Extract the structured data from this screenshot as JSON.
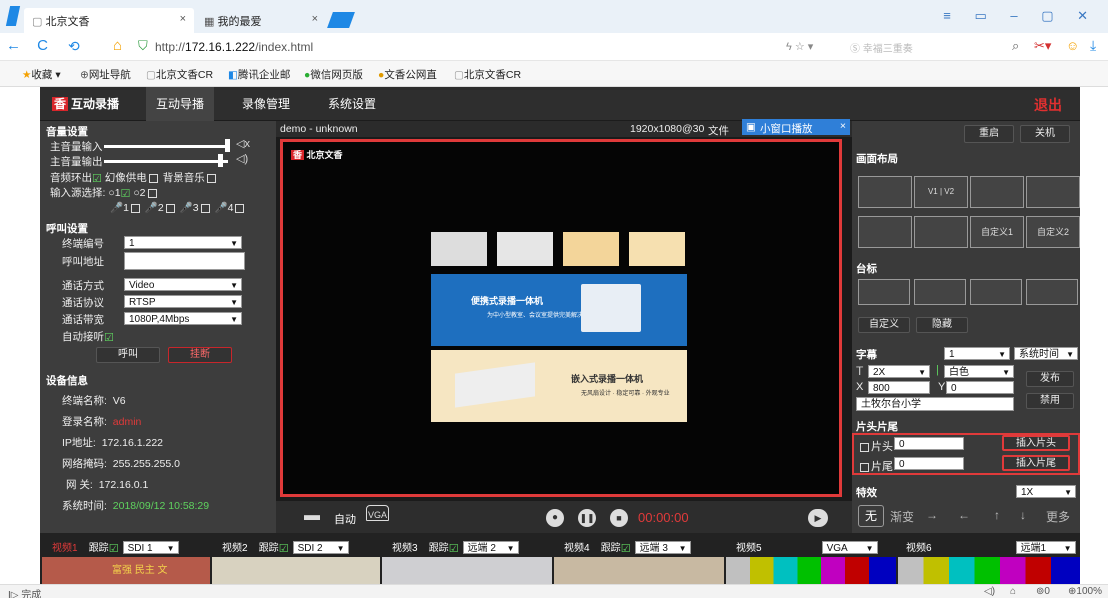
{
  "browser": {
    "tabs": [
      {
        "label": "北京文香",
        "close": "×"
      },
      {
        "label": "我的最爱",
        "close": "×"
      }
    ],
    "url_prefix": "http://",
    "url_host": "172.16.1.222",
    "url_path": "/index.html",
    "search_placeholder": "幸福三重奏",
    "favorites": [
      "收藏",
      "网址导航",
      "北京文香CR",
      "腾讯企业邮",
      "微信网页版",
      "文香公网直",
      "北京文香CR"
    ],
    "status_left": "完成",
    "status_right": [
      "0",
      "100%"
    ]
  },
  "nav": {
    "app_name": "互动录播",
    "items": [
      "互动导播",
      "录像管理",
      "系统设置"
    ],
    "logout": "退出"
  },
  "audio": {
    "title": "音量设置",
    "input_label": "主音量输入",
    "output_label": "主音量输出",
    "loop": "音频环出",
    "phantom": "幻像供电",
    "bgm": "背景音乐",
    "source_label": "输入源选择:",
    "opt1": "1",
    "opt2": "2",
    "mics": [
      "1",
      "2",
      "3",
      "4"
    ]
  },
  "call": {
    "title": "呼叫设置",
    "term_no_label": "终端编号",
    "term_no": "1",
    "addr_label": "呼叫地址",
    "addr": "",
    "mode_label": "通话方式",
    "mode": "Video",
    "proto_label": "通话协议",
    "proto": "RTSP",
    "bw_label": "通话带宽",
    "bw": "1080P,4Mbps",
    "auto_label": "自动接听",
    "call_btn": "呼叫",
    "hangup_btn": "挂断"
  },
  "device": {
    "title": "设备信息",
    "name_label": "终端名称:",
    "name": "V6",
    "login_label": "登录名称:",
    "login": "admin",
    "ip_label": "IP地址:",
    "ip": "172.16.1.222",
    "mask_label": "网络掩码:",
    "mask": "255.255.255.0",
    "gw_label": "网 关:",
    "gw": "172.16.0.1",
    "time_label": "系统时间:",
    "time": "2018/09/12 10:58:29"
  },
  "video": {
    "title": "demo - unknown",
    "res": "1920x1080@30",
    "file": "文件",
    "popup_label": "小窗口播放",
    "popup_close": "×",
    "logo_text": "北京文香",
    "banner_title": "便携式录播一体机",
    "banner_sub": "为中小型教室、会议室提供完美解决方案",
    "panel2_title": "嵌入式录播一体机",
    "panel2_sub": "无风扇设计  · 稳定可靠  · 外观专业",
    "auto_label": "自动",
    "vga_label": "VGA",
    "timer": "00:00:00"
  },
  "right": {
    "restart": "重启",
    "shutdown": "关机",
    "layout_title": "画面布局",
    "v1": "V1",
    "v2": "V2",
    "custom1": "自定义1",
    "custom2": "自定义2",
    "logo_title": "台标",
    "custom": "自定义",
    "hide": "隐藏",
    "caption_title": "字幕",
    "caption_no": "1",
    "caption_time": "系统时间",
    "size": "2X",
    "color": "白色",
    "x_label": "X",
    "x": "800",
    "y_label": "Y",
    "y": "0",
    "caption_text": "土牧尔台小学",
    "publish": "发布",
    "disable": "禁用",
    "head_tail_title": "片头片尾",
    "head_label": "片头",
    "head_val": "0",
    "tail_label": "片尾",
    "tail_val": "0",
    "insert_head": "插入片头",
    "insert_tail": "插入片尾",
    "effect_title": "特效",
    "effect_speed": "1X",
    "effects": [
      "无",
      "渐变",
      "→",
      "←",
      "↑",
      "↓",
      "更多"
    ]
  },
  "channels": [
    {
      "name": "视频1",
      "track": "跟踪",
      "src": "SDI 1"
    },
    {
      "name": "视频2",
      "track": "跟踪",
      "src": "SDI 2"
    },
    {
      "name": "视频3",
      "track": "跟踪",
      "src": "远端 2"
    },
    {
      "name": "视频4",
      "track": "跟踪",
      "src": "远端 3"
    },
    {
      "name": "视频5",
      "track": "",
      "src": "VGA"
    },
    {
      "name": "视频6",
      "track": "",
      "src": "远端1"
    }
  ],
  "thumb1_text": "富强 民主 文",
  "colors": {
    "accent_red": "#e03a3a",
    "check_green": "#5fd35f",
    "banner_blue": "#1e6fbf",
    "panel_cream": "#f6e6c2"
  }
}
